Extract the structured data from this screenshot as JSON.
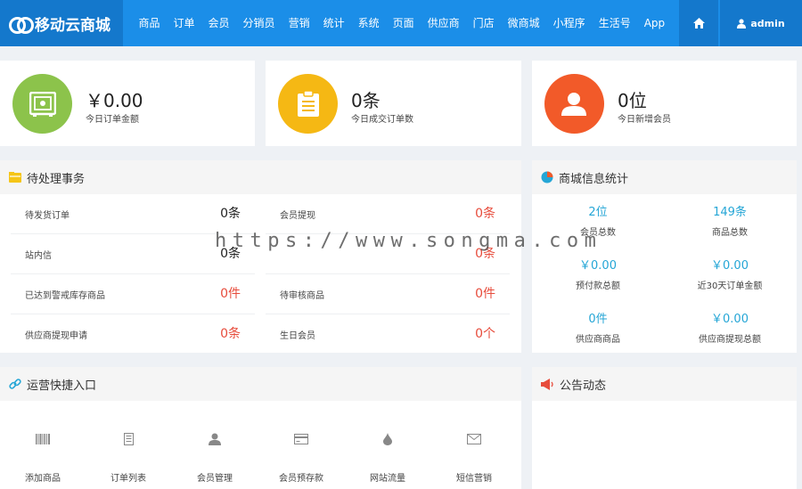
{
  "app": {
    "logo_text": "移动云商城"
  },
  "nav": {
    "items": [
      "商品",
      "订单",
      "会员",
      "分销员",
      "营销",
      "统计",
      "系统",
      "页面",
      "供应商",
      "门店",
      "微商城",
      "小程序",
      "生活号",
      "App"
    ],
    "user": "admin"
  },
  "stats": [
    {
      "value": "￥0.00",
      "label": "今日订单金额",
      "icon": "safe-icon",
      "color": "#8cc34b"
    },
    {
      "value": "0条",
      "label": "今日成交订单数",
      "icon": "clipboard-icon",
      "color": "#f5b814"
    },
    {
      "value": "0位",
      "label": "今日新增会员",
      "icon": "user-icon",
      "color": "#f25a29"
    }
  ],
  "todo": {
    "title": "待处理事务",
    "items": [
      {
        "label": "待发货订单",
        "value": "0条"
      },
      {
        "label": "会员提现",
        "value": "0条"
      },
      {
        "label": "站内信",
        "value": "0条"
      },
      {
        "label": "",
        "value": "0条"
      },
      {
        "label": "已达到警戒库存商品",
        "value": "0件"
      },
      {
        "label": "待审核商品",
        "value": "0件"
      },
      {
        "label": "供应商提现申请",
        "value": "0条"
      },
      {
        "label": "生日会员",
        "value": "0个"
      }
    ]
  },
  "mall_stats": {
    "title": "商城信息统计",
    "items": [
      {
        "value": "2位",
        "label": "会员总数"
      },
      {
        "value": "149条",
        "label": "商品总数"
      },
      {
        "value": "￥0.00",
        "label": "预付款总额"
      },
      {
        "value": "￥0.00",
        "label": "近30天订单金额"
      },
      {
        "value": "0件",
        "label": "供应商商品"
      },
      {
        "value": "￥0.00",
        "label": "供应商提现总额"
      }
    ]
  },
  "quick": {
    "title": "运营快捷入口",
    "items": [
      {
        "label": "添加商品",
        "icon": "barcode-icon"
      },
      {
        "label": "订单列表",
        "icon": "document-icon"
      },
      {
        "label": "会员管理",
        "icon": "person-icon"
      },
      {
        "label": "会员预存款",
        "icon": "card-icon"
      },
      {
        "label": "网站流量",
        "icon": "drop-icon"
      },
      {
        "label": "短信营销",
        "icon": "envelope-icon"
      }
    ]
  },
  "notice": {
    "title": "公告动态"
  },
  "watermark": "https://www.songma.com"
}
